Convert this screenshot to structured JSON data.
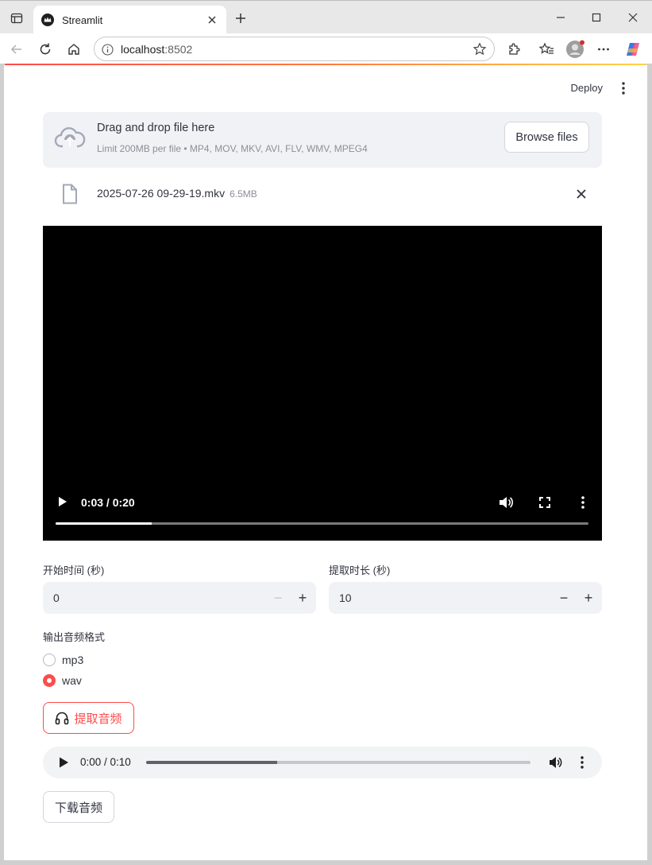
{
  "browser": {
    "tab_title": "Streamlit",
    "url_host": "localhost",
    "url_port": ":8502"
  },
  "header": {
    "deploy_label": "Deploy"
  },
  "uploader": {
    "title": "Drag and drop file here",
    "limit": "Limit 200MB per file • MP4, MOV, MKV, AVI, FLV, WMV, MPEG4",
    "browse_label": "Browse files",
    "file_name": "2025-07-26 09-29-19.mkv",
    "file_size": "6.5MB"
  },
  "video": {
    "time": "0:03 / 0:20",
    "progress": 0.18
  },
  "start_time": {
    "label": "开始时间 (秒)",
    "value": "0"
  },
  "duration": {
    "label": "提取时长 (秒)",
    "value": "10"
  },
  "format": {
    "label": "输出音频格式",
    "options": [
      "mp3",
      "wav"
    ],
    "selected": "wav"
  },
  "extract_button": {
    "label": "提取音频"
  },
  "audio": {
    "time": "0:00 / 0:10",
    "progress": 0.34
  },
  "download_button": {
    "label": "下载音频"
  },
  "colors": {
    "primary": "#ff4b4b",
    "secondary_bg": "#f0f2f6",
    "text": "#31333f"
  },
  "icons": [
    "sidebar-toggle-icon",
    "streamlit-crown-icon",
    "close-icon",
    "plus-icon",
    "minimize-icon",
    "maximize-icon",
    "back-icon",
    "reload-icon",
    "home-icon",
    "info-icon",
    "star-icon",
    "extensions-icon",
    "favorites-icon",
    "profile-icon",
    "more-icon",
    "copilot-icon",
    "cloud-upload-icon",
    "file-icon",
    "headphones-icon",
    "play-icon",
    "volume-icon",
    "fullscreen-icon"
  ]
}
